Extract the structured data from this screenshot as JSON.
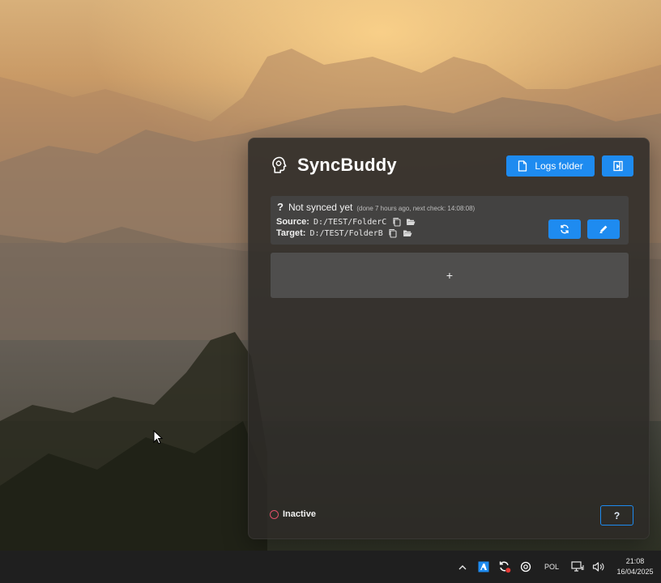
{
  "app": {
    "title": "SyncBuddy",
    "logs_button_label": "Logs folder",
    "add_label": "+",
    "footer_status": "Inactive",
    "help_label": "?",
    "accent_color": "#1e8bf0",
    "inactive_color": "#e0506a"
  },
  "sync_item": {
    "status_icon": "?",
    "status": "Not synced yet",
    "detail": "(done 7 hours ago, next check: 14:08:08)",
    "source_label": "Source:",
    "source_path": "D:/TEST/FolderC",
    "target_label": "Target:",
    "target_path": "D:/TEST/FolderB"
  },
  "taskbar": {
    "chevron": "^",
    "language": "POL",
    "time": "21:08",
    "date": "16/04/2025",
    "icons": [
      "azure-icon",
      "sync-error-icon",
      "app-tray-icon",
      "network-icon",
      "volume-icon"
    ]
  }
}
